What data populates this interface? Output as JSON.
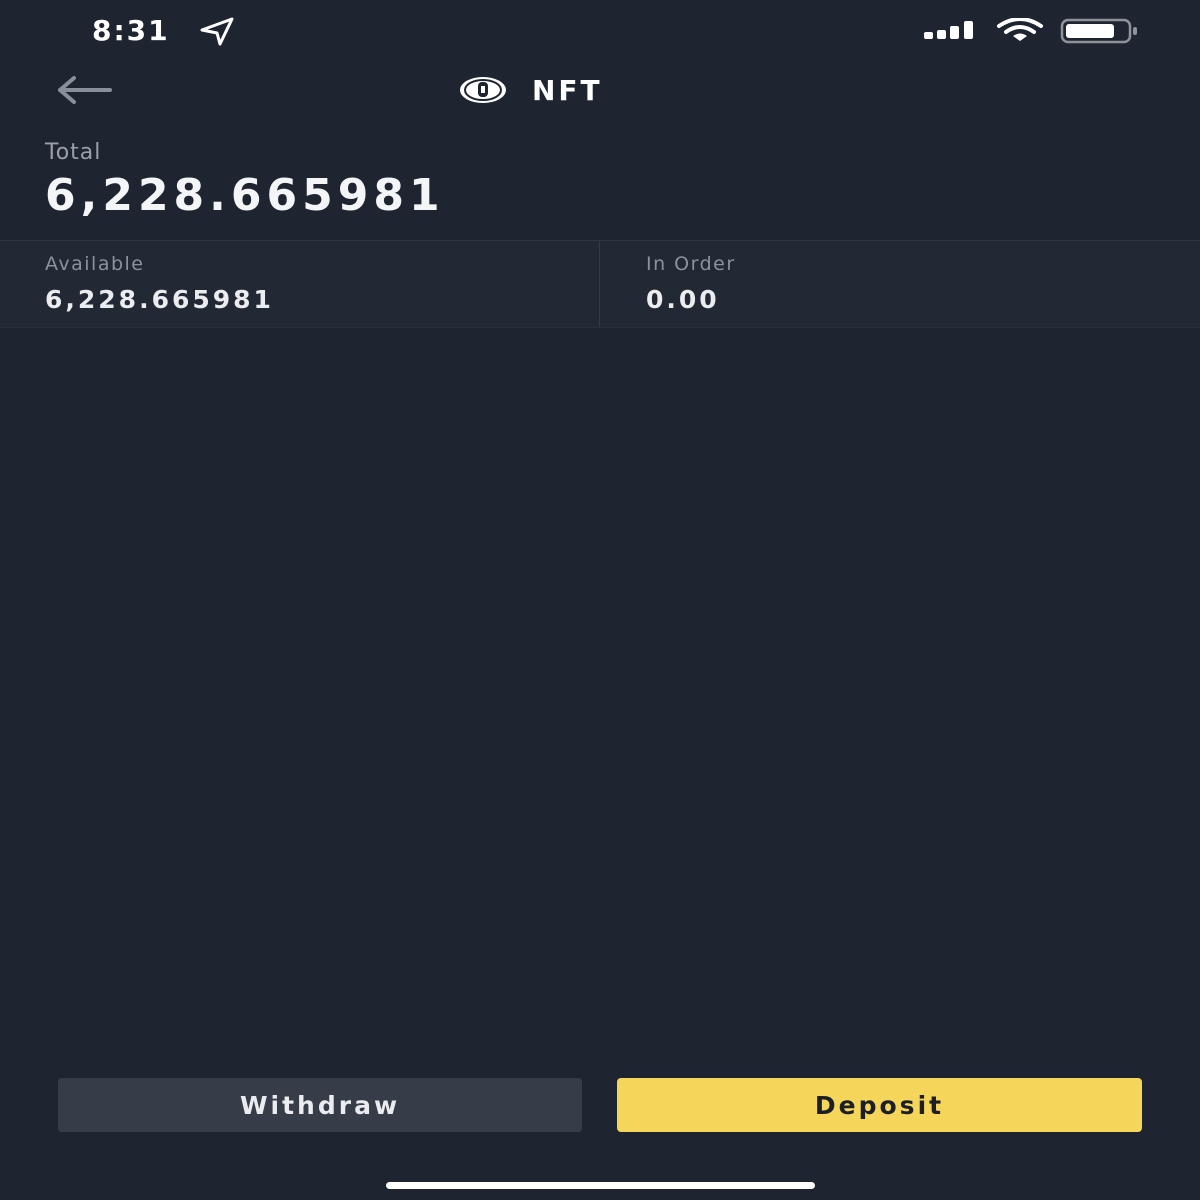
{
  "status_bar": {
    "time": "8:31"
  },
  "header": {
    "title": "NFT",
    "icons": {
      "back": "arrow-left-icon",
      "coin": "nft-coin-icon"
    }
  },
  "total": {
    "label": "Total",
    "value": "6,228.665981"
  },
  "balances": {
    "available": {
      "label": "Available",
      "value": "6,228.665981"
    },
    "in_order": {
      "label": "In Order",
      "value": "0.00"
    }
  },
  "actions": {
    "withdraw_label": "Withdraw",
    "deposit_label": "Deposit"
  },
  "colors": {
    "background": "#1f2530",
    "deposit_accent": "#f5d55a",
    "withdraw_bg": "#363c48"
  }
}
